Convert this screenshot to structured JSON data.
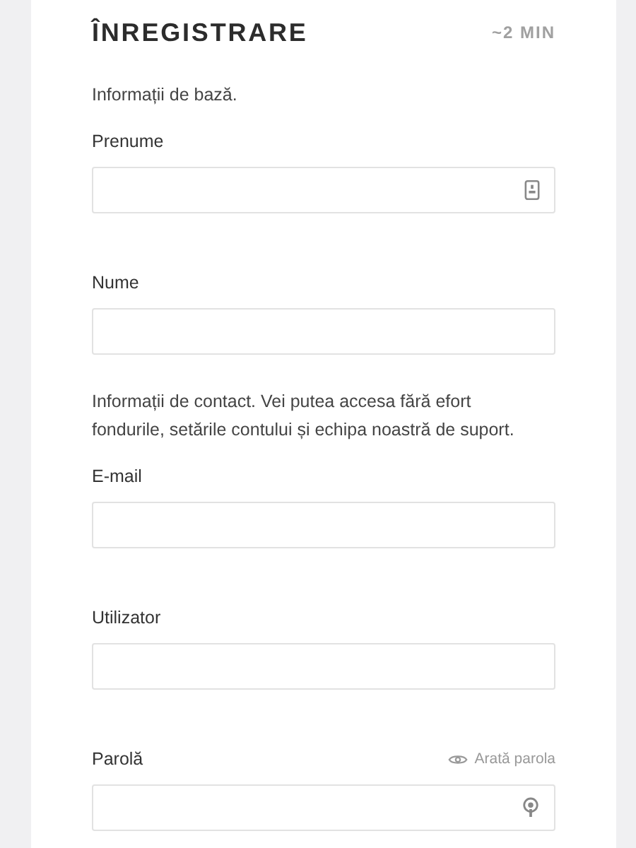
{
  "header": {
    "title": "ÎNREGISTRARE",
    "duration": "~2 MIN"
  },
  "blocks": [
    {
      "kind": "note",
      "text": "Informații de bază."
    },
    {
      "kind": "name_field",
      "label": "Prenume"
    },
    {
      "kind": "field",
      "label": "Nume"
    },
    {
      "kind": "note",
      "text": "Informații de contact. Vei putea accesa fără efort fondurile, setările contului și echipa noastră de suport."
    },
    {
      "kind": "field",
      "label": "E-mail"
    },
    {
      "kind": "field",
      "label": "Utilizator"
    },
    {
      "kind": "password_field",
      "label": "Parolă",
      "toggle": "Arată parola"
    }
  ]
}
